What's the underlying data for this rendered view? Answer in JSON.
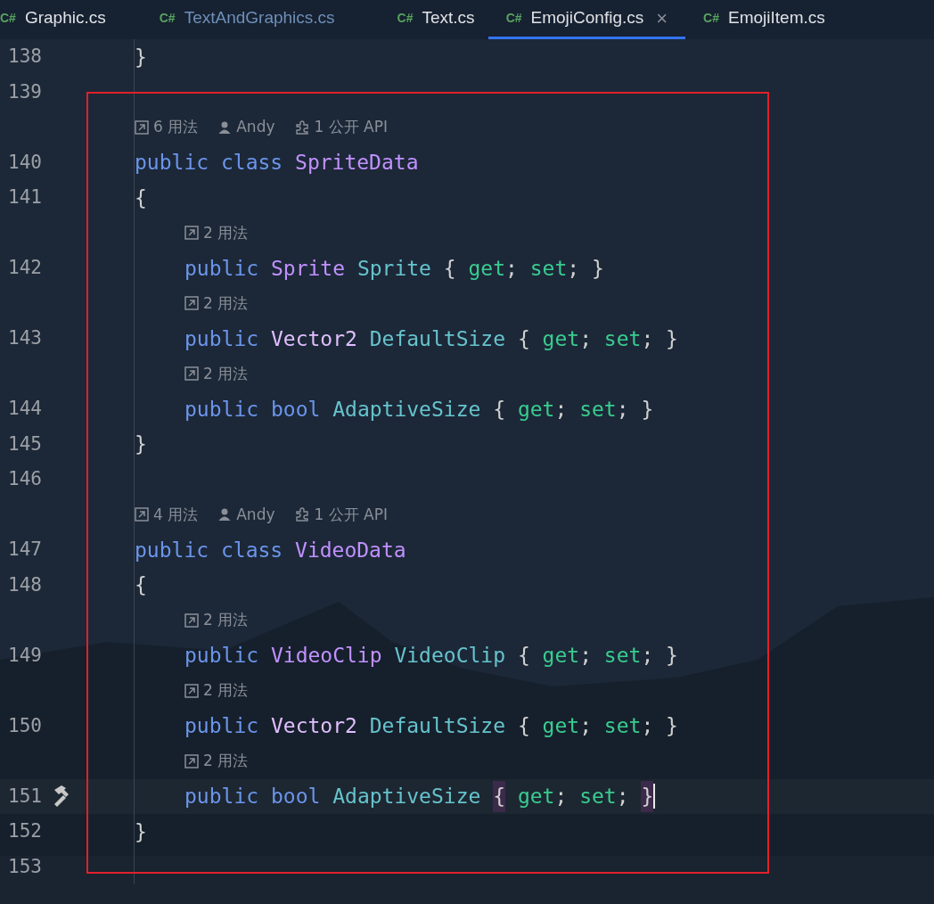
{
  "tabs": [
    {
      "label": "Graphic.cs",
      "lang": "C#",
      "selected": false,
      "changed": false
    },
    {
      "label": "TextAndGraphics.cs",
      "lang": "C#",
      "selected": false,
      "changed": true
    },
    {
      "label": "Text.cs",
      "lang": "C#",
      "selected": false,
      "changed": false
    },
    {
      "label": "EmojiConfig.cs",
      "lang": "C#",
      "selected": true,
      "changed": false,
      "close": "×"
    },
    {
      "label": "EmojiItem.cs",
      "lang": "C#",
      "selected": false,
      "changed": false
    }
  ],
  "lines": [
    {
      "kind": "code",
      "number": "138",
      "current": false,
      "tokens": [
        {
          "text": "}",
          "kind": "punct"
        }
      ]
    },
    {
      "kind": "code",
      "number": "139",
      "current": false
    },
    {
      "kind": "hint",
      "items": [
        {
          "kind": "usages",
          "text": "6 用法"
        },
        {
          "kind": "author",
          "text": "Andy"
        },
        {
          "kind": "api",
          "text": "1 公开 API"
        }
      ]
    },
    {
      "kind": "code",
      "number": "140",
      "current": false,
      "tokens": [
        {
          "text": "public ",
          "kind": "kw"
        },
        {
          "text": "class ",
          "kind": "kw"
        },
        {
          "text": "SpriteData",
          "kind": "cls"
        }
      ]
    },
    {
      "kind": "code",
      "number": "141",
      "current": false,
      "tokens": [
        {
          "text": "{",
          "kind": "punct"
        }
      ],
      "children": [
        {
          "kind": "hint",
          "items": [
            {
              "kind": "usages",
              "text": "2 用法"
            }
          ]
        },
        {
          "kind": "code",
          "number": "142",
          "current": false,
          "tokens": [
            {
              "text": "public ",
              "kind": "kw"
            },
            {
              "text": "Sprite ",
              "kind": "cls"
            },
            {
              "text": "Sprite ",
              "kind": "prop"
            },
            {
              "text": "{ ",
              "kind": "punct"
            },
            {
              "text": "get",
              "kind": "acc"
            },
            {
              "text": "; ",
              "kind": "punct"
            },
            {
              "text": "set",
              "kind": "acc"
            },
            {
              "text": "; }",
              "kind": "punct"
            }
          ]
        },
        {
          "kind": "hint",
          "items": [
            {
              "kind": "usages",
              "text": "2 用法"
            }
          ]
        },
        {
          "kind": "code",
          "number": "143",
          "current": false,
          "tokens": [
            {
              "text": "public ",
              "kind": "kw"
            },
            {
              "text": "Vector2 ",
              "kind": "struct"
            },
            {
              "text": "DefaultSize ",
              "kind": "prop"
            },
            {
              "text": "{ ",
              "kind": "punct"
            },
            {
              "text": "get",
              "kind": "acc"
            },
            {
              "text": "; ",
              "kind": "punct"
            },
            {
              "text": "set",
              "kind": "acc"
            },
            {
              "text": "; }",
              "kind": "punct"
            }
          ]
        },
        {
          "kind": "hint",
          "items": [
            {
              "kind": "usages",
              "text": "2 用法"
            }
          ]
        },
        {
          "kind": "code",
          "number": "144",
          "current": false,
          "tokens": [
            {
              "text": "public ",
              "kind": "kw"
            },
            {
              "text": "bool ",
              "kind": "kw"
            },
            {
              "text": "AdaptiveSize ",
              "kind": "prop"
            },
            {
              "text": "{ ",
              "kind": "punct"
            },
            {
              "text": "get",
              "kind": "acc"
            },
            {
              "text": "; ",
              "kind": "punct"
            },
            {
              "text": "set",
              "kind": "acc"
            },
            {
              "text": "; }",
              "kind": "punct"
            }
          ]
        }
      ]
    },
    {
      "kind": "code",
      "number": "145",
      "current": false,
      "tokens": [
        {
          "text": "}",
          "kind": "punct"
        }
      ]
    },
    {
      "kind": "code",
      "number": "146",
      "current": false
    },
    {
      "kind": "hint",
      "items": [
        {
          "kind": "usages",
          "text": "4 用法"
        },
        {
          "kind": "author",
          "text": "Andy"
        },
        {
          "kind": "api",
          "text": "1 公开 API"
        }
      ]
    },
    {
      "kind": "code",
      "number": "147",
      "current": false,
      "tokens": [
        {
          "text": "public ",
          "kind": "kw"
        },
        {
          "text": "class ",
          "kind": "kw"
        },
        {
          "text": "VideoData",
          "kind": "cls"
        }
      ]
    },
    {
      "kind": "code",
      "number": "148",
      "current": false,
      "tokens": [
        {
          "text": "{",
          "kind": "punct"
        }
      ],
      "children": [
        {
          "kind": "hint",
          "items": [
            {
              "kind": "usages",
              "text": "2 用法"
            }
          ]
        },
        {
          "kind": "code",
          "number": "149",
          "current": false,
          "tokens": [
            {
              "text": "public ",
              "kind": "kw"
            },
            {
              "text": "VideoClip ",
              "kind": "cls"
            },
            {
              "text": "VideoClip ",
              "kind": "prop"
            },
            {
              "text": "{ ",
              "kind": "punct"
            },
            {
              "text": "get",
              "kind": "acc"
            },
            {
              "text": "; ",
              "kind": "punct"
            },
            {
              "text": "set",
              "kind": "acc"
            },
            {
              "text": "; }",
              "kind": "punct"
            }
          ]
        },
        {
          "kind": "hint",
          "items": [
            {
              "kind": "usages",
              "text": "2 用法"
            }
          ]
        },
        {
          "kind": "code",
          "number": "150",
          "current": false,
          "tokens": [
            {
              "text": "public ",
              "kind": "kw"
            },
            {
              "text": "Vector2 ",
              "kind": "struct"
            },
            {
              "text": "DefaultSize ",
              "kind": "prop"
            },
            {
              "text": "{ ",
              "kind": "punct"
            },
            {
              "text": "get",
              "kind": "acc"
            },
            {
              "text": "; ",
              "kind": "punct"
            },
            {
              "text": "set",
              "kind": "acc"
            },
            {
              "text": "; }",
              "kind": "punct"
            }
          ]
        },
        {
          "kind": "hint",
          "items": [
            {
              "kind": "usages",
              "text": "2 用法"
            }
          ]
        },
        {
          "kind": "code",
          "number": "151",
          "current": true,
          "gutter": {
            "kind": "hammer"
          },
          "tokens": [
            {
              "text": "public ",
              "kind": "kw"
            },
            {
              "text": "bool ",
              "kind": "kw"
            },
            {
              "text": "AdaptiveSize ",
              "kind": "prop"
            },
            {
              "text": "{",
              "kind": "brace"
            },
            {
              "text": " get",
              "kind": "acc"
            },
            {
              "text": "; ",
              "kind": "punct"
            },
            {
              "text": "set",
              "kind": "acc"
            },
            {
              "text": "; ",
              "kind": "punct"
            },
            {
              "text": "}",
              "kind": "brace"
            }
          ]
        }
      ]
    },
    {
      "kind": "code",
      "number": "152",
      "current": false,
      "tokens": [
        {
          "text": "}",
          "kind": "punct"
        }
      ]
    },
    {
      "kind": "code",
      "number": "153",
      "current": false
    }
  ]
}
